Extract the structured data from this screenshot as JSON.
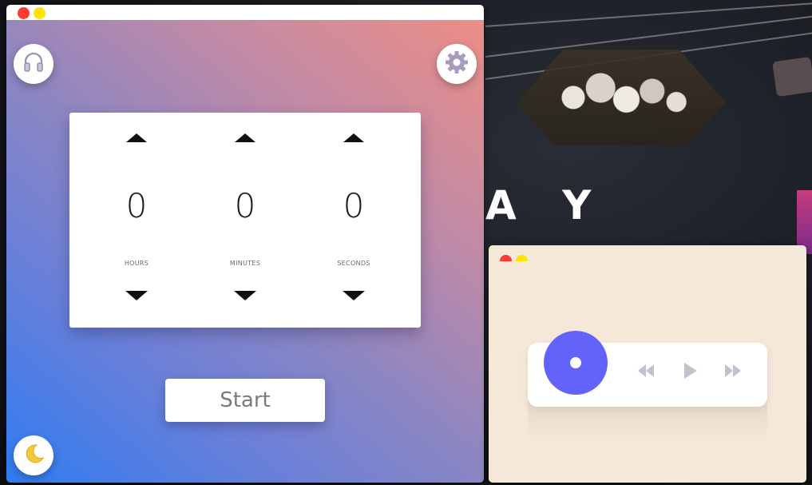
{
  "timer": {
    "hours": {
      "value": "0",
      "label": "HOURS"
    },
    "minutes": {
      "value": "0",
      "label": "MINUTES"
    },
    "seconds": {
      "value": "0",
      "label": "SECONDS"
    },
    "start_label": "Start",
    "icons": {
      "left_top": "headphones-icon",
      "right_top": "gear-icon",
      "left_bottom": "moon-icon"
    }
  },
  "desktop": {
    "wallpaper_text": "A Y"
  },
  "player": {
    "controls": [
      "rewind-icon",
      "play-icon",
      "fast-forward-icon"
    ]
  },
  "colors": {
    "close": "#ff3b30",
    "minimize": "#ffe600",
    "disc": "#6362fb",
    "control_icon": "#bfc3cf",
    "player_bg": "#f6e8d9"
  }
}
